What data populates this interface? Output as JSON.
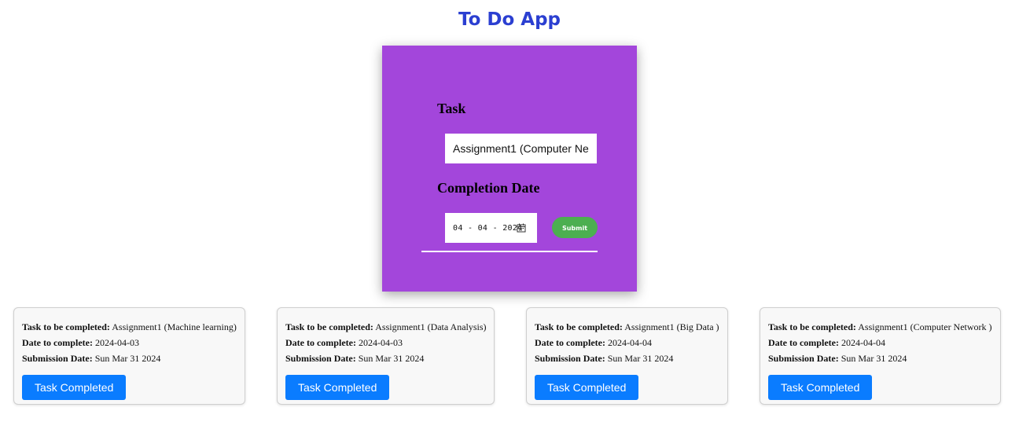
{
  "app": {
    "title": "To Do App"
  },
  "form": {
    "task_label": "Task",
    "task_value": "Assignment1 (Computer Ne",
    "date_label": "Completion Date",
    "date_value": "04 - 04 - 2024",
    "submit_label": "Submit"
  },
  "labels": {
    "task": "Task to be completed:",
    "date": "Date to complete:",
    "submission": "Submission Date:"
  },
  "tasks": [
    {
      "task": "Assignment1 (Machine learning)",
      "date": "2024-04-03",
      "submission": "Sun Mar 31 2024",
      "button": "Task Completed"
    },
    {
      "task": "Assignment1 (Data Analysis)",
      "date": "2024-04-03",
      "submission": "Sun Mar 31 2024",
      "button": "Task Completed"
    },
    {
      "task": "Assignment1 (Big Data )",
      "date": "2024-04-04",
      "submission": "Sun Mar 31 2024",
      "button": "Task Completed"
    },
    {
      "task": "Assignment1 (Computer Network )",
      "date": "2024-04-04",
      "submission": "Sun Mar 31 2024",
      "button": "Task Completed"
    }
  ],
  "colors": {
    "title": "#2b3fd1",
    "form_background": "#a346db",
    "submit_button": "#4caf50",
    "complete_button": "#0a7cff"
  },
  "icons": {
    "date_picker": "calendar-icon"
  }
}
